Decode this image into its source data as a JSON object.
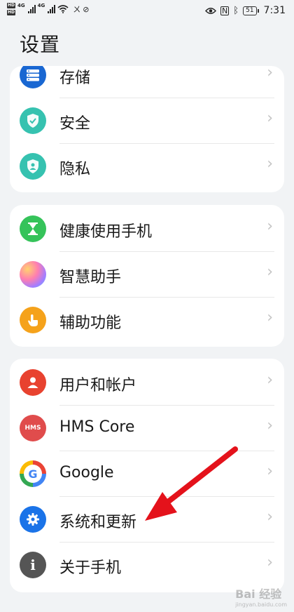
{
  "status_bar": {
    "carrier_tags": [
      "HD",
      "HD"
    ],
    "network_1": "4G",
    "network_2": "4G",
    "time": "7:31",
    "battery": "51"
  },
  "page_title": "设置",
  "groups": [
    {
      "items": [
        {
          "label": "存储",
          "icon": "storage-icon",
          "color": "#1967d2"
        },
        {
          "label": "安全",
          "icon": "security-shield-icon",
          "color": "#36c2b0"
        },
        {
          "label": "隐私",
          "icon": "privacy-shield-icon",
          "color": "#36c2b0"
        }
      ]
    },
    {
      "items": [
        {
          "label": "健康使用手机",
          "icon": "hourglass-icon",
          "color": "#35c35a"
        },
        {
          "label": "智慧助手",
          "icon": "assistant-orb-icon",
          "color": "#c28cff"
        },
        {
          "label": "辅助功能",
          "icon": "hand-tap-icon",
          "color": "#f5a21b"
        }
      ]
    },
    {
      "items": [
        {
          "label": "用户和帐户",
          "icon": "user-icon",
          "color": "#e8422f"
        },
        {
          "label": "HMS Core",
          "icon": "hms-icon",
          "color": "#e04c4c"
        },
        {
          "label": "Google",
          "icon": "google-icon",
          "color": "#4285f4"
        },
        {
          "label": "系统和更新",
          "icon": "gear-icon",
          "color": "#1a73e8"
        },
        {
          "label": "关于手机",
          "icon": "info-icon",
          "color": "#555555"
        }
      ]
    }
  ],
  "icon_text": {
    "hms": "HMS",
    "google": "G",
    "info": "i"
  },
  "watermark": {
    "main": "Bai 经验",
    "sub": "jingyan.baidu.com"
  }
}
